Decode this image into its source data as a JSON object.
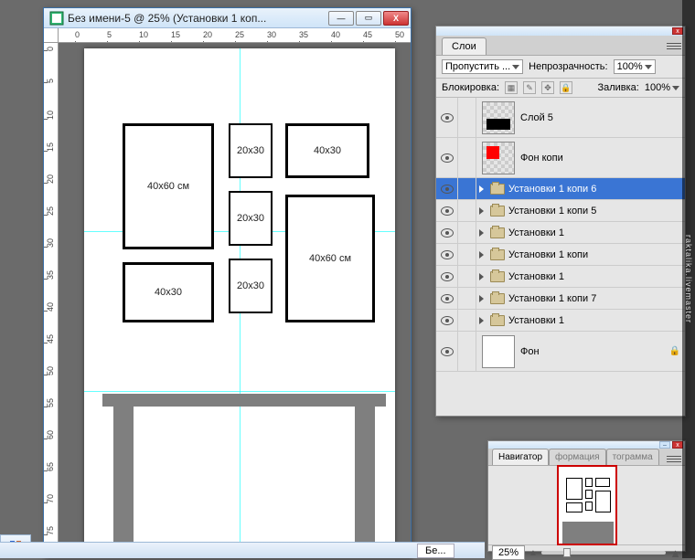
{
  "doc": {
    "title": "Без имени-5 @ 25% (Установки 1 коп...",
    "ruler_h": [
      "0",
      "5",
      "10",
      "15",
      "20",
      "25",
      "30",
      "35",
      "40",
      "45",
      "50"
    ],
    "ruler_v": [
      "0",
      "5",
      "10",
      "15",
      "20",
      "25",
      "30",
      "35",
      "40",
      "45",
      "50",
      "55",
      "60",
      "65",
      "70",
      "75"
    ],
    "frames": {
      "big1": "40х60 см",
      "big2": "40х60 см",
      "mid1": "40х30",
      "mid2": "40х30",
      "small1": "20х30",
      "small2": "20х30",
      "small3": "20х30"
    }
  },
  "layers_panel": {
    "tab": "Слои",
    "blend_label": "Пропустить ...",
    "opacity_label": "Непрозрачность:",
    "opacity_value": "100%",
    "lock_label": "Блокировка:",
    "fill_label": "Заливка:",
    "fill_value": "100%",
    "rows": [
      {
        "name": "Слой 5",
        "big": true,
        "thumb": "black"
      },
      {
        "name": "Фон копи",
        "big": true,
        "thumb": "red"
      },
      {
        "name": "Установки 1 копи 6",
        "sel": true,
        "folder": true
      },
      {
        "name": "Установки 1 копи 5",
        "folder": true
      },
      {
        "name": "Установки 1",
        "folder": true
      },
      {
        "name": "Установки 1 копи",
        "folder": true
      },
      {
        "name": "Установки 1",
        "folder": true
      },
      {
        "name": "Установки 1 копи 7",
        "folder": true
      },
      {
        "name": "Установки 1",
        "folder": true
      },
      {
        "name": "Фон",
        "big": true,
        "thumb": "white",
        "locked": true
      }
    ]
  },
  "navigator": {
    "tabs": [
      "Навигатор",
      "формация",
      "тограмма"
    ],
    "zoom": "25%"
  },
  "taskbar": {
    "item": "Бе..."
  },
  "watermark": "raktalika.livemaster",
  "win_btns": {
    "min": "—",
    "max": "▭",
    "close": "X"
  }
}
